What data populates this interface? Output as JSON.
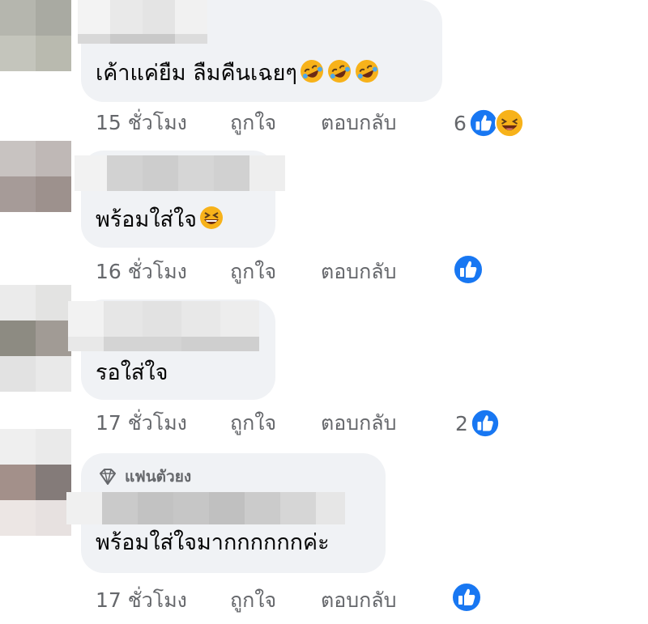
{
  "comments": [
    {
      "text": "เค้าแค่ยืม ลืมคืนเฉยๆ",
      "time": "15 ชั่วโมง",
      "like_label": "ถูกใจ",
      "reply_label": "ตอบกลับ",
      "reaction_count": "6",
      "reactions": [
        "like",
        "laughing"
      ],
      "emojis": [
        "rofl",
        "rofl",
        "rofl"
      ]
    },
    {
      "text": "พร้อมใส่ใจ",
      "time": "16 ชั่วโมง",
      "like_label": "ถูกใจ",
      "reply_label": "ตอบกลับ",
      "reaction_count": "",
      "reactions": [
        "like"
      ],
      "emojis": [
        "grinning-squint"
      ]
    },
    {
      "text": "รอใส่ใจ",
      "time": "17 ชั่วโมง",
      "like_label": "ถูกใจ",
      "reply_label": "ตอบกลับ",
      "reaction_count": "2",
      "reactions": [
        "like"
      ],
      "emojis": []
    },
    {
      "text": "พร้อมใส่ใจมากกกกกกค่ะ",
      "badge": "แฟนตัวยง",
      "time": "17 ชั่วโมง",
      "like_label": "ถูกใจ",
      "reply_label": "ตอบกลับ",
      "reaction_count": "",
      "reactions": [
        "like"
      ],
      "emojis": []
    }
  ],
  "colors": {
    "bubble": "#f0f2f5",
    "meta_text": "#65676b",
    "like_blue": "#1877f2",
    "text": "#050505"
  }
}
